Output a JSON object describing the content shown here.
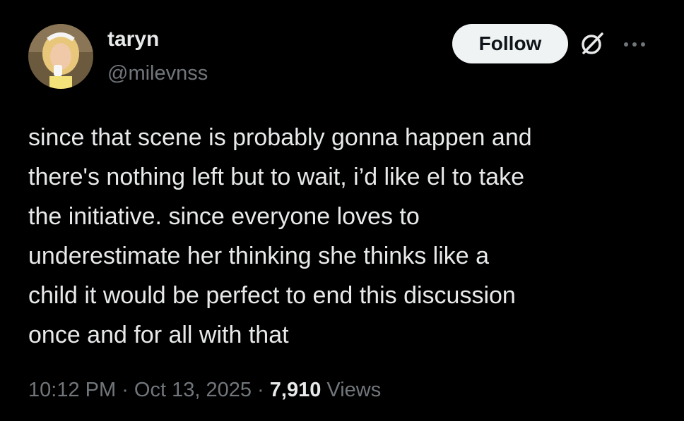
{
  "author": {
    "display_name": "taryn",
    "handle": "@milevnss",
    "avatar_icon": "profile-photo"
  },
  "actions": {
    "follow_label": "Follow",
    "grok_icon": "grok-icon",
    "more_icon": "more-options-icon"
  },
  "tweet": {
    "lines": [
      "since that scene is probably gonna happen and",
      "there's nothing left but to wait, i’d like el to take",
      "the initiative. since everyone loves to",
      "underestimate her thinking she thinks like a",
      "child it would be perfect to end this discussion",
      "once and for all with that"
    ]
  },
  "meta": {
    "time": "10:12 PM",
    "separator": " · ",
    "date": "Oct 13, 2025",
    "views_count": "7,910",
    "views_label": "Views"
  },
  "colors": {
    "background": "#000000",
    "primary_text": "#e7e9ea",
    "secondary_text": "#71767b",
    "follow_button_bg": "#eff3f4",
    "follow_button_text": "#0f1419"
  }
}
